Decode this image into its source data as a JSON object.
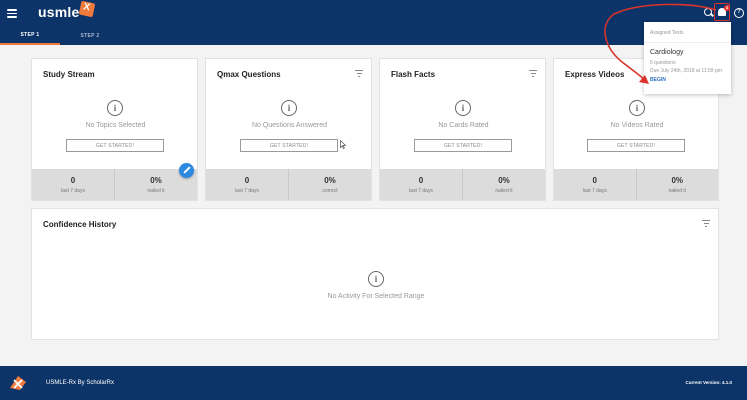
{
  "header": {
    "logo_text": "usmle",
    "tabs": [
      {
        "label": "STEP 1",
        "active": true
      },
      {
        "label": "STEP 2",
        "active": false
      }
    ],
    "notification_count": "3",
    "help_glyph": "?"
  },
  "cards": {
    "study_stream": {
      "title": "Study Stream",
      "empty_text": "No Topics Selected",
      "button_label": "GET STARTED!",
      "stat1_value": "0",
      "stat1_label": "last 7 days",
      "stat2_value": "0%",
      "stat2_label": "nailed it"
    },
    "qmax": {
      "title": "Qmax Questions",
      "empty_text": "No Questions Answered",
      "button_label": "GET STARTED!",
      "stat1_value": "0",
      "stat1_label": "last 7 days",
      "stat2_value": "0%",
      "stat2_label": "correct"
    },
    "flash_facts": {
      "title": "Flash Facts",
      "empty_text": "No Cards Rated",
      "button_label": "GET STARTED!",
      "stat1_value": "0",
      "stat1_label": "last 7 days",
      "stat2_value": "0%",
      "stat2_label": "nailed it"
    },
    "express_videos": {
      "title": "Express Videos",
      "empty_text": "No Videos Rated",
      "button_label": "GET STARTED!",
      "stat1_value": "0",
      "stat1_label": "last 7 days",
      "stat2_value": "0%",
      "stat2_label": "nailed it"
    },
    "confidence": {
      "title": "Confidence History",
      "empty_text": "No Activity For Selected Range"
    },
    "info_glyph": "i"
  },
  "notification": {
    "heading": "Assigned Tests",
    "title": "Cardiology",
    "subtitle": "5 questions",
    "due": "Due July 24th, 2018 at 11:59 pm",
    "action": "BEGIN"
  },
  "footer": {
    "brand": "USMLE-Rx By ScholarRx",
    "version": "Current Version: 4.1.0"
  },
  "colors": {
    "header_bg": "#0d3468",
    "accent": "#f07a3c",
    "annotation": "#d9332b",
    "link": "#2a6fc0",
    "fab": "#2b8ae0"
  },
  "icons": [
    "menu-icon",
    "search-icon",
    "bell-icon",
    "help-icon",
    "filter-icon",
    "info-icon",
    "pencil-icon"
  ]
}
